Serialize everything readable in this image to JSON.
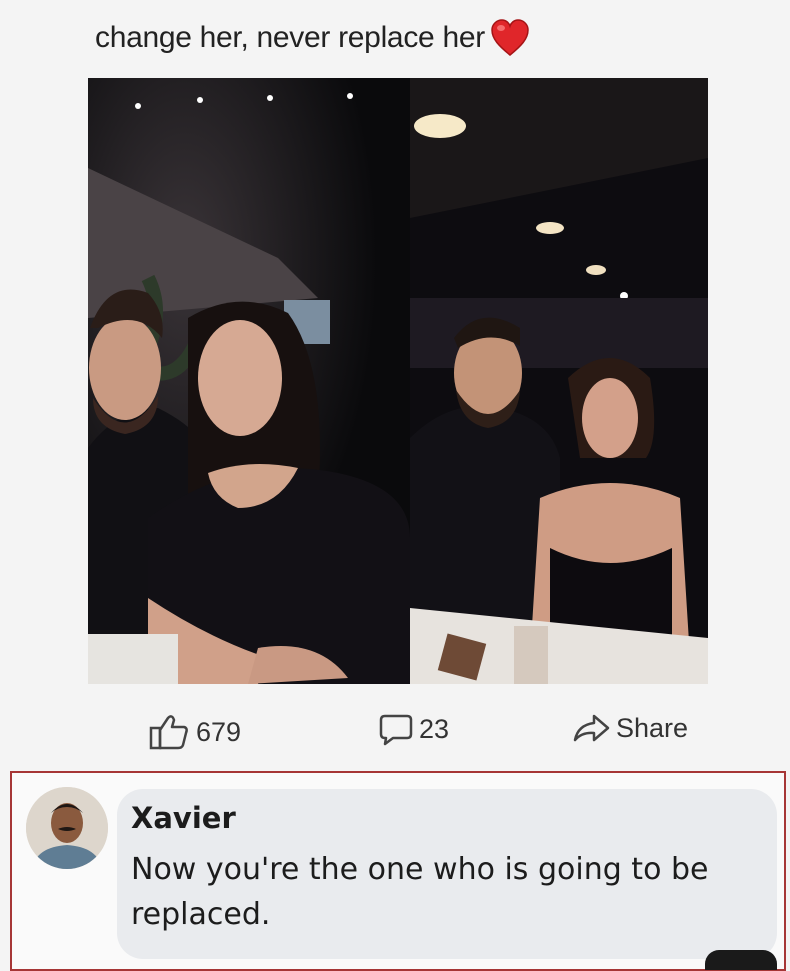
{
  "post": {
    "caption": "change her, never replace her",
    "caption_icon": "heart-icon",
    "heart_color": "#e0262a"
  },
  "actions": {
    "like_count": "679",
    "comment_count": "23",
    "share_label": "Share"
  },
  "comment": {
    "author": "Xavier",
    "text": "Now you're the one who is going to be replaced.",
    "border_color": "#a63636"
  }
}
